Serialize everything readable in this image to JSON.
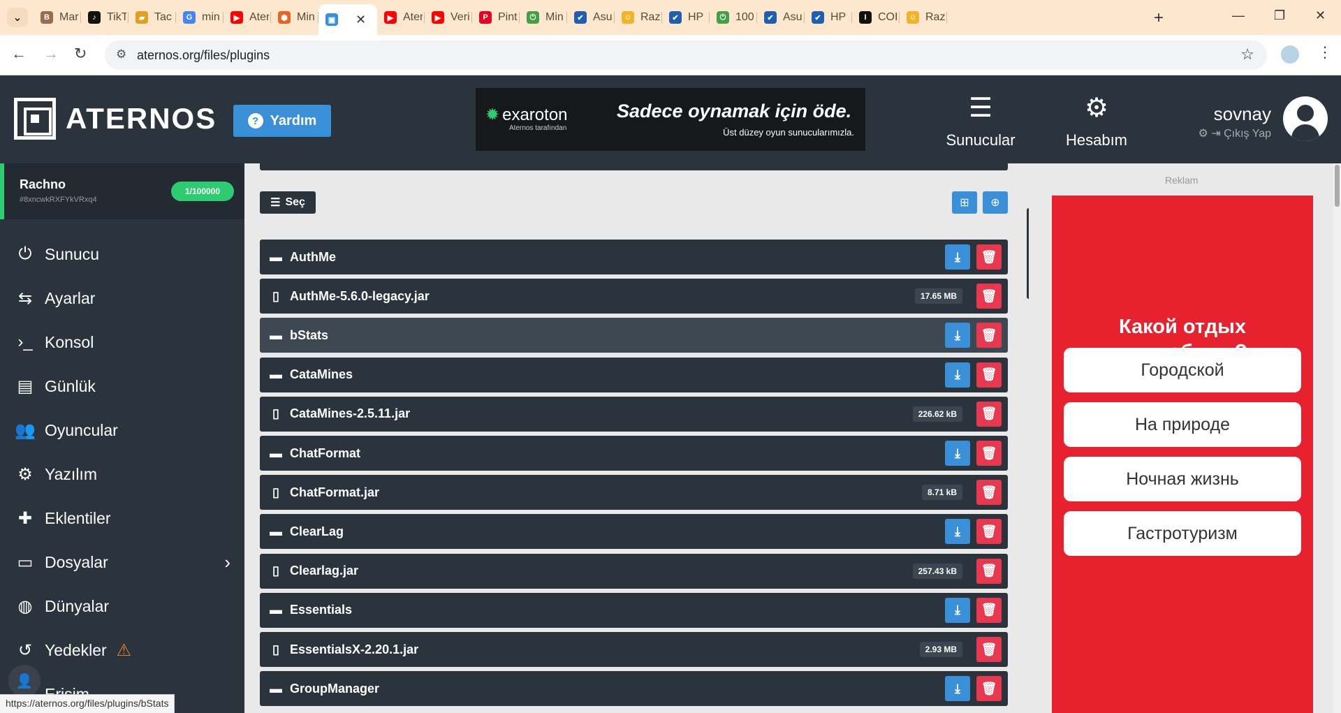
{
  "browser": {
    "tabs": [
      {
        "title": "Mar",
        "fav": "B",
        "favColor": "#9b6b4e"
      },
      {
        "title": "TikT",
        "fav": "♪",
        "favColor": "#111111"
      },
      {
        "title": "Tac",
        "fav": "▰",
        "favColor": "#e0a020"
      },
      {
        "title": "min",
        "fav": "G",
        "favColor": "#4285f4"
      },
      {
        "title": "Ater",
        "fav": "▶",
        "favColor": "#ff0000"
      },
      {
        "title": "Min",
        "fav": "⬢",
        "favColor": "#e8661c"
      },
      {
        "title": "",
        "fav": "▣",
        "favColor": "#3a8fd9",
        "active": true
      },
      {
        "title": "Ater",
        "fav": "▶",
        "favColor": "#ff0000"
      },
      {
        "title": "Veri",
        "fav": "▶",
        "favColor": "#ff0000"
      },
      {
        "title": "Pint",
        "fav": "P",
        "favColor": "#e60023"
      },
      {
        "title": "Min",
        "fav": "⏻",
        "favColor": "#43a047"
      },
      {
        "title": "Asu",
        "fav": "✔",
        "favColor": "#1e5fb0"
      },
      {
        "title": "Raz",
        "fav": "☺",
        "favColor": "#f0b429"
      },
      {
        "title": "HP",
        "fav": "✔",
        "favColor": "#1e5fb0"
      },
      {
        "title": "100",
        "fav": "⏻",
        "favColor": "#43a047"
      },
      {
        "title": "Asu",
        "fav": "✔",
        "favColor": "#1e5fb0"
      },
      {
        "title": "HP",
        "fav": "✔",
        "favColor": "#1e5fb0"
      },
      {
        "title": "COI",
        "fav": "I",
        "favColor": "#111111"
      },
      {
        "title": "Raz",
        "fav": "☺",
        "favColor": "#f0b429"
      }
    ],
    "url": "aternos.org/files/plugins",
    "status_url": "https://aternos.org/files/plugins/bStats"
  },
  "header": {
    "logo": "ATERNOS",
    "help": "Yardım",
    "ad": {
      "brand": "exaroton",
      "brand_sub": "Aternos tarafından",
      "headline": "Sadece oynamak için öde.",
      "sub": "Üst düzey oyun sunucularımızla."
    },
    "nav": [
      {
        "label": "Sunucular",
        "icon": "servers-icon"
      },
      {
        "label": "Hesabım",
        "icon": "account-settings-icon"
      }
    ],
    "user": {
      "name": "sovnay",
      "logout": "Çıkış Yap"
    }
  },
  "server": {
    "name": "Rachno",
    "id": "#8xncwkRXFYkVRxq4",
    "count": "1/100000"
  },
  "sidebar": {
    "items": [
      {
        "label": "Sunucu",
        "icon": "power-icon"
      },
      {
        "label": "Ayarlar",
        "icon": "settings-sliders-icon"
      },
      {
        "label": "Konsol",
        "icon": "terminal-icon"
      },
      {
        "label": "Günlük",
        "icon": "log-file-icon"
      },
      {
        "label": "Oyuncular",
        "icon": "players-icon"
      },
      {
        "label": "Yazılım",
        "icon": "software-gears-icon"
      },
      {
        "label": "Eklentiler",
        "icon": "puzzle-icon"
      },
      {
        "label": "Dosyalar",
        "icon": "folders-icon"
      },
      {
        "label": "Dünyalar",
        "icon": "globe-icon"
      },
      {
        "label": "Yedekler",
        "icon": "history-icon"
      },
      {
        "label": "Erişim",
        "icon": "access-users-icon"
      }
    ]
  },
  "files": {
    "select_label": "Seç",
    "items": [
      {
        "name": "AuthMe",
        "type": "folder"
      },
      {
        "name": "AuthMe-5.6.0-legacy.jar",
        "type": "file",
        "size": "17.65 MB"
      },
      {
        "name": "bStats",
        "type": "folder",
        "highlighted": true
      },
      {
        "name": "CataMines",
        "type": "folder"
      },
      {
        "name": "CataMines-2.5.11.jar",
        "type": "file",
        "size": "226.62 kB"
      },
      {
        "name": "ChatFormat",
        "type": "folder"
      },
      {
        "name": "ChatFormat.jar",
        "type": "file",
        "size": "8.71 kB"
      },
      {
        "name": "ClearLag",
        "type": "folder"
      },
      {
        "name": "Clearlag.jar",
        "type": "file",
        "size": "257.43 kB"
      },
      {
        "name": "Essentials",
        "type": "folder"
      },
      {
        "name": "EssentialsX-2.20.1.jar",
        "type": "file",
        "size": "2.93 MB"
      },
      {
        "name": "GroupManager",
        "type": "folder"
      }
    ]
  },
  "right_ad": {
    "label": "Reklam",
    "title_line1": "Какой отдых",
    "title_line2": "ты любишь?",
    "options": [
      "Городской",
      "На природе",
      "Ночная жизнь",
      "Гастротуризм"
    ]
  },
  "colors": {
    "accent_blue": "#3a8fd9",
    "danger": "#e8384f",
    "success": "#2ecc71",
    "panel": "#2b333c"
  }
}
